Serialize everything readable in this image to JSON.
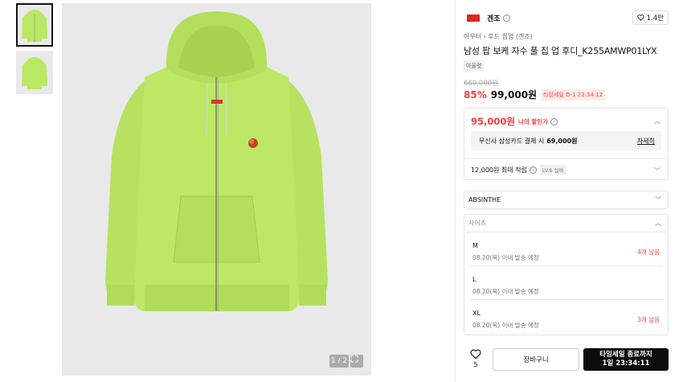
{
  "gallery": {
    "pager": "1 / 2",
    "thumb_count": 2,
    "hoodie_color": "#b9e862"
  },
  "brand": {
    "name": "겐조",
    "likes": "1.4만"
  },
  "product": {
    "breadcrumb": "아우터 › 후드 집업 (겐조)",
    "title": "남성 팝 보케 자수 풀 집 업 후디_K255AMWP01LYX",
    "tag": "아울렛",
    "original_price": "660,000원",
    "discount_rate": "85%",
    "sale_price": "99,000원",
    "timesale_label": "타임세일 D-1 23:34:12"
  },
  "discount_card": {
    "my_price": "95,000원",
    "my_price_label": "나의 할인가",
    "card_text": "무신사 삼성카드 결제 시",
    "card_price": "69,000원",
    "detail_link": "자세히",
    "points": "12,000원 최대 적립",
    "level_badge": "LV.6 실버"
  },
  "options": {
    "color_value": "ABSINTHE",
    "size_placeholder": "사이즈",
    "sizes": [
      {
        "name": "M",
        "ship": "08.20(목) 이내 발송 예정",
        "stock": "4개 남음"
      },
      {
        "name": "L",
        "ship": "08.20(목) 이내 발송 예정",
        "stock": ""
      },
      {
        "name": "XL",
        "ship": "08.20(목) 이내 발송 예정",
        "stock": "3개 남음"
      }
    ]
  },
  "actions": {
    "fav_count": "5",
    "cart_label": "장바구니",
    "buy_line1": "타임세일 종료까지",
    "buy_line2": "1일 23:34:11"
  },
  "colors": {
    "accent_red": "#ff3b3b",
    "brand_red": "#e0281e",
    "buy_bg": "#0c0c0c"
  }
}
